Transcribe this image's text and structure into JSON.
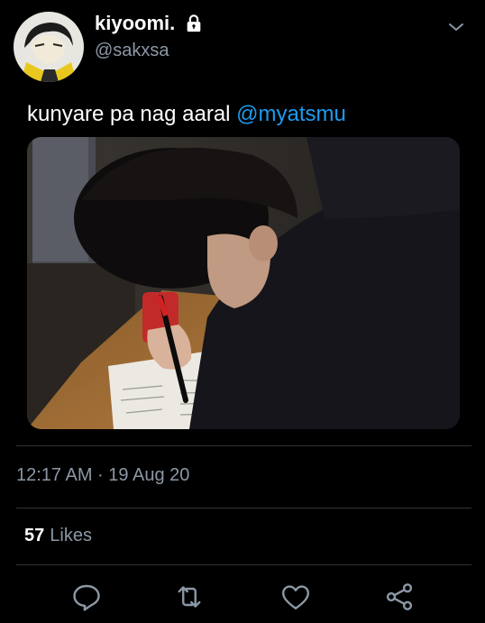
{
  "tweet": {
    "author": {
      "display_name": "kiyoomi.",
      "handle": "@sakxsa",
      "protected_icon": "lock-icon",
      "avatar": "anime-avatar"
    },
    "text": "kunyare pa nag aaral",
    "mention": "@myatsmu",
    "media": {
      "type": "photo"
    },
    "timestamp": "12:17 AM · 19 Aug 20",
    "likes": {
      "count": "57",
      "label": "Likes"
    },
    "actions": [
      "reply-icon",
      "retweet-icon",
      "like-icon",
      "share-icon"
    ]
  },
  "colors": {
    "background": "#000000",
    "text_secondary": "#8b98a5",
    "link": "#1d9bf0",
    "divider": "#2f3336"
  }
}
